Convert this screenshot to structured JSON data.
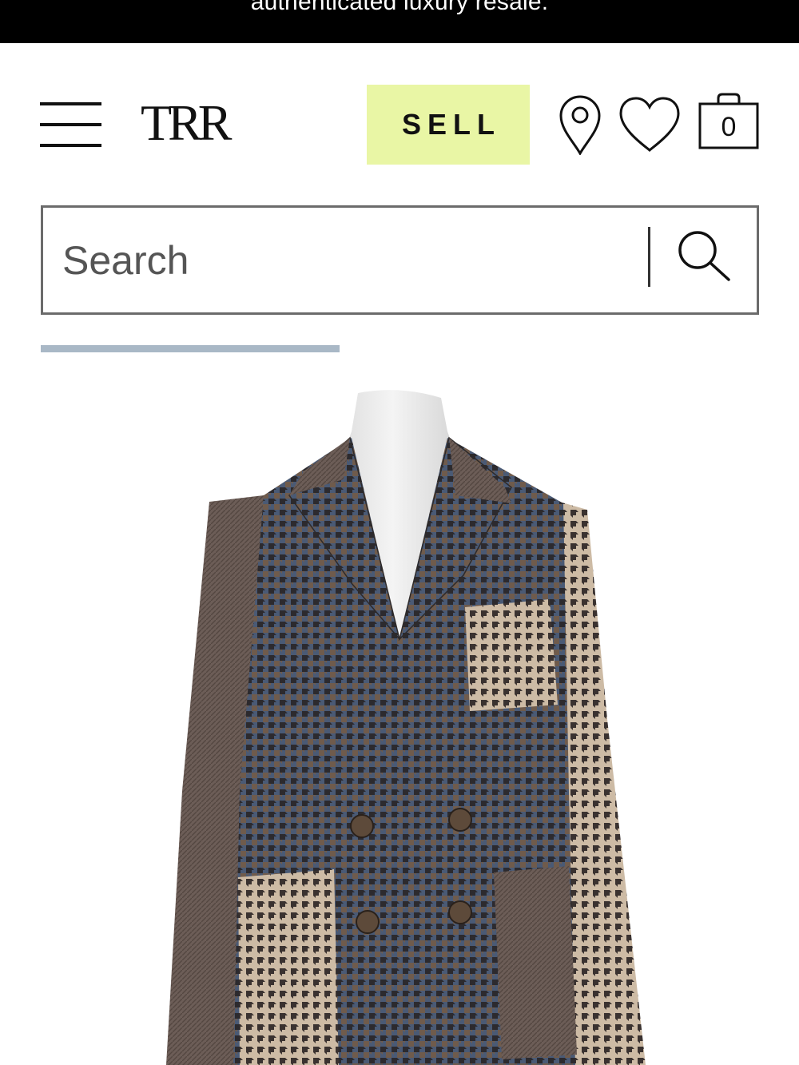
{
  "banner": {
    "text": "authenticated luxury resale."
  },
  "header": {
    "logo": "TRR",
    "sell_label": "SELL",
    "cart_count": "0"
  },
  "search": {
    "placeholder": "Search"
  },
  "carousel": {
    "progress": 0.416
  },
  "icons": {
    "menu": "hamburger-menu-icon",
    "location": "location-pin-icon",
    "favorites": "heart-icon",
    "cart": "shopping-bag-icon",
    "search": "magnifier-icon"
  },
  "colors": {
    "banner_bg": "#000000",
    "sell_bg": "#e9f6a5",
    "progress": "#a9b8c6",
    "search_border": "#6b6b6b"
  }
}
